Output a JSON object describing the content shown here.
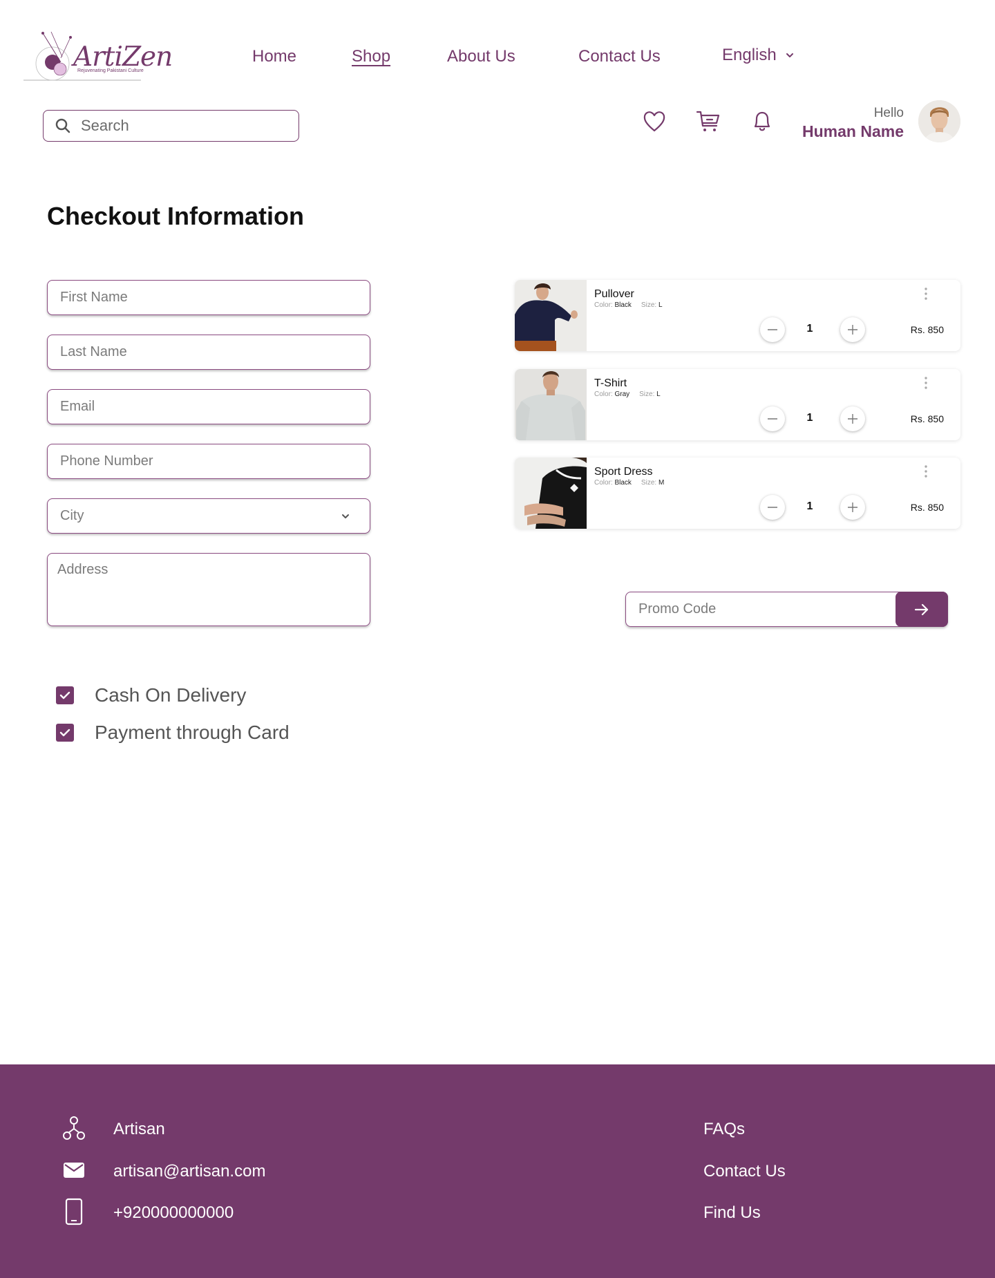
{
  "brand": {
    "name": "ArtiZen",
    "tagline": "Rejuvenating Pakistani Culture"
  },
  "nav": {
    "items": [
      {
        "label": "Home",
        "active": false
      },
      {
        "label": "Shop",
        "active": true
      },
      {
        "label": "About Us",
        "active": false
      },
      {
        "label": "Contact Us",
        "active": false
      }
    ],
    "language": "English"
  },
  "search": {
    "placeholder": "Search"
  },
  "user": {
    "greeting": "Hello",
    "name": "Human Name"
  },
  "header_icons": [
    "heart-icon",
    "cart-icon",
    "bell-icon"
  ],
  "page_title": "Checkout Information",
  "form": {
    "first_name": "First Name",
    "last_name": "Last Name",
    "email": "Email",
    "phone": "Phone Number",
    "city": "City",
    "address": "Address"
  },
  "payment": [
    {
      "label": "Cash On Delivery",
      "checked": true
    },
    {
      "label": "Payment through Card",
      "checked": true
    }
  ],
  "cart": {
    "items": [
      {
        "name": "Pullover",
        "color_label": "Color:",
        "color": "Black",
        "size_label": "Size:",
        "size": "L",
        "qty": "1",
        "price": "Rs. 850"
      },
      {
        "name": "T-Shirt",
        "color_label": "Color:",
        "color": "Gray",
        "size_label": "Size:",
        "size": "L",
        "qty": "1",
        "price": "Rs. 850"
      },
      {
        "name": "Sport Dress",
        "color_label": "Color:",
        "color": "Black",
        "size_label": "Size:",
        "size": "M",
        "qty": "1",
        "price": "Rs. 850"
      }
    ]
  },
  "promo": {
    "placeholder": "Promo Code"
  },
  "footer": {
    "contact": [
      {
        "icon": "org-icon",
        "text": "Artisan"
      },
      {
        "icon": "mail-icon",
        "text": "artisan@artisan.com"
      },
      {
        "icon": "phone-icon",
        "text": "+920000000000"
      }
    ],
    "links": [
      "FAQs",
      "Contact Us",
      "Find Us"
    ]
  },
  "colors": {
    "brand": "#743a6b",
    "text": "#222222",
    "muted": "#7b7b7b"
  }
}
